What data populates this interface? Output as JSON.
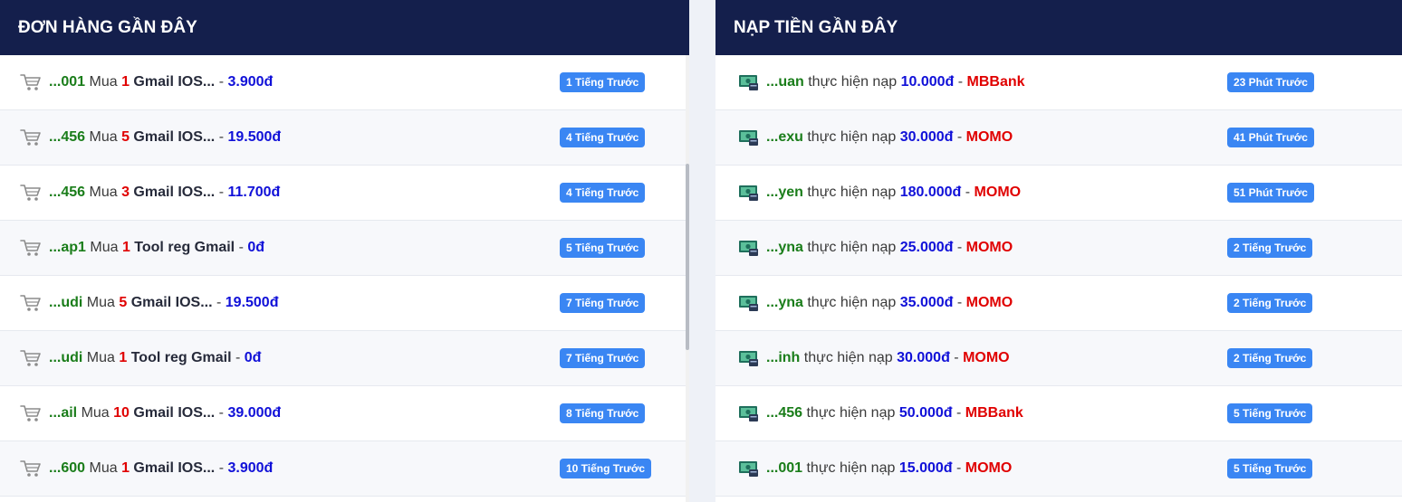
{
  "orders": {
    "title": "ĐƠN HÀNG GẦN ĐÂY",
    "verb": "Mua",
    "sep": "-",
    "items": [
      {
        "user": "...001",
        "qty": "1",
        "product": "Gmail IOS...",
        "price": "3.900đ",
        "time": "1 Tiếng Trước"
      },
      {
        "user": "...456",
        "qty": "5",
        "product": "Gmail IOS...",
        "price": "19.500đ",
        "time": "4 Tiếng Trước"
      },
      {
        "user": "...456",
        "qty": "3",
        "product": "Gmail IOS...",
        "price": "11.700đ",
        "time": "4 Tiếng Trước"
      },
      {
        "user": "...ap1",
        "qty": "1",
        "product": "Tool reg Gmail",
        "price": "0đ",
        "time": "5 Tiếng Trước"
      },
      {
        "user": "...udi",
        "qty": "5",
        "product": "Gmail IOS...",
        "price": "19.500đ",
        "time": "7 Tiếng Trước"
      },
      {
        "user": "...udi",
        "qty": "1",
        "product": "Tool reg Gmail",
        "price": "0đ",
        "time": "7 Tiếng Trước"
      },
      {
        "user": "...ail",
        "qty": "10",
        "product": "Gmail IOS...",
        "price": "39.000đ",
        "time": "8 Tiếng Trước"
      },
      {
        "user": "...600",
        "qty": "1",
        "product": "Gmail IOS...",
        "price": "3.900đ",
        "time": "10 Tiếng Trước"
      }
    ]
  },
  "topups": {
    "title": "NẠP TIỀN GẦN ĐÂY",
    "verb": "thực hiện nạp",
    "sep": "-",
    "items": [
      {
        "user": "...uan",
        "amount": "10.000đ",
        "method": "MBBank",
        "time": "23 Phút Trước"
      },
      {
        "user": "...exu",
        "amount": "30.000đ",
        "method": "MOMO",
        "time": "41 Phút Trước"
      },
      {
        "user": "...yen",
        "amount": "180.000đ",
        "method": "MOMO",
        "time": "51 Phút Trước"
      },
      {
        "user": "...yna",
        "amount": "25.000đ",
        "method": "MOMO",
        "time": "2 Tiếng Trước"
      },
      {
        "user": "...yna",
        "amount": "35.000đ",
        "method": "MOMO",
        "time": "2 Tiếng Trước"
      },
      {
        "user": "...inh",
        "amount": "30.000đ",
        "method": "MOMO",
        "time": "2 Tiếng Trước"
      },
      {
        "user": "...456",
        "amount": "50.000đ",
        "method": "MBBank",
        "time": "5 Tiếng Trước"
      },
      {
        "user": "...001",
        "amount": "15.000đ",
        "method": "MOMO",
        "time": "5 Tiếng Trước"
      }
    ]
  },
  "icons": {
    "order": "shopping-cart-icon",
    "topup": "money-card-icon"
  },
  "colors": {
    "header": "#141f4c",
    "badge": "#3a86f3",
    "user": "#1a7d1a",
    "qty": "#e00000",
    "price": "#1010d8",
    "method": "#e00000"
  }
}
